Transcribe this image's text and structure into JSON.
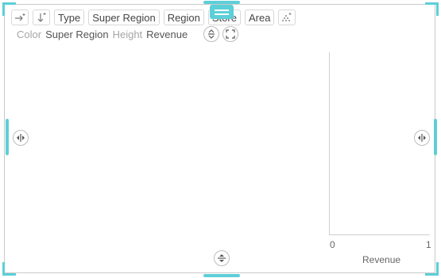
{
  "toolbar": {
    "items": [
      "Type",
      "Super Region",
      "Region",
      "Store",
      "Area"
    ]
  },
  "props": {
    "color_label": "Color",
    "color_value": "Super Region",
    "height_label": "Height",
    "height_value": "Revenue"
  },
  "chart": {
    "x_tick_min": "0",
    "x_tick_max": "1",
    "x_axis_title": "Revenue"
  },
  "colors": {
    "accent": "#5dcfd8",
    "border": "#c9c9c9"
  }
}
